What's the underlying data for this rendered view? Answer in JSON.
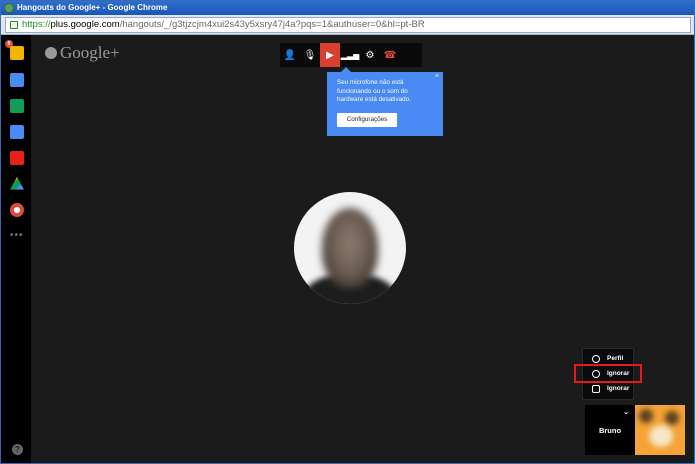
{
  "window": {
    "title": "Hangouts do Google+ - Google Chrome"
  },
  "address_bar": {
    "scheme": "https://",
    "host": "plus.google.com",
    "path": "/hangouts/_/g3tjzcjm4xui2s43y5xsry47j4a?pqs=1&authuser=0&hl=pt-BR"
  },
  "sidebar": {
    "badge": "0",
    "items": [
      {
        "name": "profile",
        "color": "#f4b400"
      },
      {
        "name": "chat",
        "color": "#4a8af4"
      },
      {
        "name": "share",
        "color": "#0f9d58"
      },
      {
        "name": "camera",
        "color": "#4a8af4"
      },
      {
        "name": "youtube",
        "color": "#e62117"
      },
      {
        "name": "drive",
        "color": "#0f9d58"
      },
      {
        "name": "help-ring",
        "color": "#dd4b39"
      }
    ],
    "more": "•••",
    "help": "?"
  },
  "logo": {
    "text": "Google+"
  },
  "toolbar": {
    "buttons": [
      {
        "name": "invite",
        "glyph": "👤"
      },
      {
        "name": "mic-muted",
        "glyph": "🎙"
      },
      {
        "name": "camera-off",
        "glyph": "▶"
      },
      {
        "name": "bandwidth",
        "glyph": "▂▃▅"
      },
      {
        "name": "settings",
        "glyph": "⚙"
      },
      {
        "name": "hangup",
        "glyph": "☎"
      }
    ]
  },
  "notice": {
    "text": "Seu microfone não está funcionando ou o som do hardware está desativado.",
    "close": "×",
    "button_label": "Configurações"
  },
  "context_menu": {
    "items": [
      {
        "label": "Perfil"
      },
      {
        "label": "Ignorar"
      },
      {
        "label": "Ignorar"
      }
    ]
  },
  "participant": {
    "name": "Bruno",
    "caret": "⌄"
  },
  "colors": {
    "accent": "#4a8af4",
    "danger": "#d93f2f",
    "highlight": "#e31b1b"
  }
}
